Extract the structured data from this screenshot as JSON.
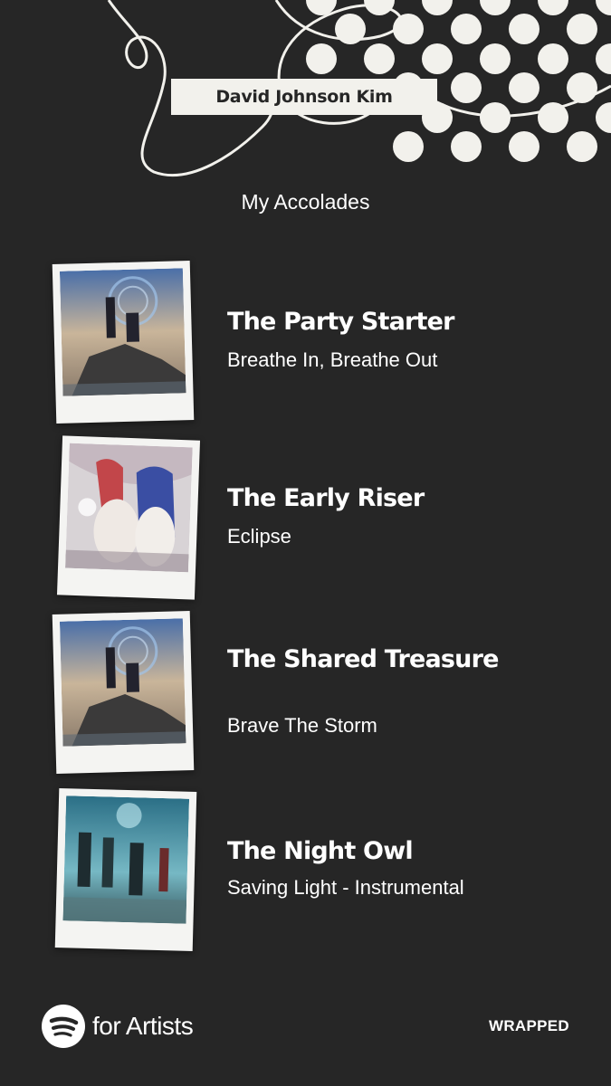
{
  "header": {
    "artist_name": "David Johnson Kim",
    "section_title": "My Accolades"
  },
  "accolades": [
    {
      "title": "The Party Starter",
      "track": "Breathe In, Breathe Out",
      "art": "artwork-rock-duo"
    },
    {
      "title": "The Early Riser",
      "track": "Eclipse",
      "art": "artwork-two-heroines"
    },
    {
      "title": "The Shared Treasure",
      "track": "Brave The Storm",
      "art": "artwork-rock-duo"
    },
    {
      "title": "The Night Owl",
      "track": "Saving Light - Instrumental",
      "art": "artwork-group-walk"
    }
  ],
  "footer": {
    "brand": "for Artists",
    "wrapped_label": "WRAPPED",
    "logo_icon": "spotify-logo-icon"
  },
  "colors": {
    "background": "#262626",
    "accent_light": "#f2f1ec",
    "text": "#ffffff"
  }
}
